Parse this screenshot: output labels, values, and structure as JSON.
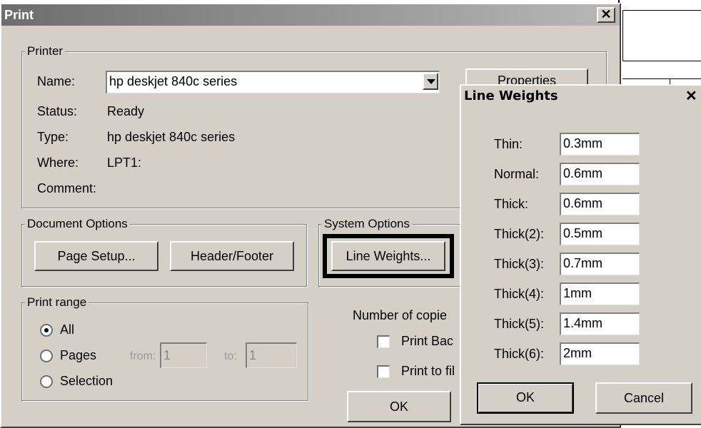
{
  "print_dialog": {
    "title": "Print",
    "printer_group": {
      "legend": "Printer",
      "name_label": "Name:",
      "name_value": "hp deskjet 840c series",
      "properties_label": "Properties",
      "status_label": "Status:",
      "status_value": "Ready",
      "type_label": "Type:",
      "type_value": "hp deskjet 840c series",
      "where_label": "Where:",
      "where_value": "LPT1:",
      "comment_label": "Comment:"
    },
    "document_options": {
      "legend": "Document Options",
      "page_setup_label": "Page Setup...",
      "header_footer_label": "Header/Footer"
    },
    "system_options": {
      "legend": "System Options",
      "line_weights_label": "Line Weights..."
    },
    "print_range": {
      "legend": "Print range",
      "all_label": "All",
      "pages_label": "Pages",
      "from_label": "from:",
      "from_value": "1",
      "to_label": "to:",
      "to_value": "1",
      "selection_label": "Selection",
      "selected": "All"
    },
    "copies": {
      "label": "Number of copie",
      "print_background_label": "Print Bac",
      "print_to_file_label": "Print to fil"
    },
    "ok_label": "OK"
  },
  "line_weights_dialog": {
    "title": "Line Weights",
    "rows": [
      {
        "label": "Thin:",
        "value": "0.3mm"
      },
      {
        "label": "Normal:",
        "value": "0.6mm"
      },
      {
        "label": "Thick:",
        "value": "0.6mm"
      },
      {
        "label": "Thick(2):",
        "value": "0.5mm"
      },
      {
        "label": "Thick(3):",
        "value": "0.7mm"
      },
      {
        "label": "Thick(4):",
        "value": "1mm"
      },
      {
        "label": "Thick(5):",
        "value": "1.4mm"
      },
      {
        "label": "Thick(6):",
        "value": "2mm"
      }
    ],
    "ok_label": "OK",
    "cancel_label": "Cancel"
  },
  "icons": {
    "close": "close-icon",
    "dropdown": "chevron-down-icon"
  },
  "colors": {
    "dialog_face": "#d4d0c8",
    "titlebar_gradient_start": "#6d6d6d",
    "highlight_frame": "#000000"
  }
}
